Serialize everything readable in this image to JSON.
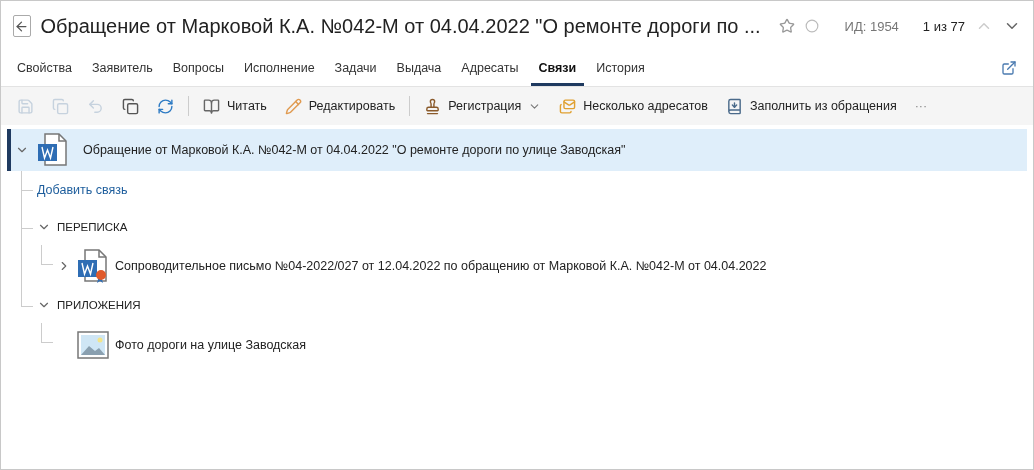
{
  "header": {
    "title": "Обращение от Марковой К.А. №042-М от 04.04.2022 \"О ремонте дороги по ...",
    "starred": false,
    "id_label": "ИД: 1954",
    "pager": "1 из 77",
    "prev_disabled": true
  },
  "tabs": [
    {
      "label": "Свойства",
      "selected": false
    },
    {
      "label": "Заявитель",
      "selected": false
    },
    {
      "label": "Вопросы",
      "selected": false
    },
    {
      "label": "Исполнение",
      "selected": false
    },
    {
      "label": "Задачи",
      "selected": false
    },
    {
      "label": "Выдача",
      "selected": false
    },
    {
      "label": "Адресаты",
      "selected": false
    },
    {
      "label": "Связи",
      "selected": true
    },
    {
      "label": "История",
      "selected": false
    }
  ],
  "toolbar": {
    "icon_buttons": [
      {
        "disabled": true
      },
      {
        "disabled": true
      },
      {
        "disabled": true
      },
      {
        "disabled": false
      },
      {
        "disabled": false
      }
    ],
    "actions": [
      {
        "label": "Читать",
        "dropdown": false
      },
      {
        "label": "Редактировать",
        "dropdown": false
      },
      {
        "label": "Регистрация",
        "dropdown": true
      },
      {
        "label": "Несколько адресатов",
        "dropdown": false
      },
      {
        "label": "Заполнить из обращения",
        "dropdown": false
      }
    ],
    "more": "···"
  },
  "tree": {
    "label": "Обращение от Марковой К.А. №042-М от 04.04.2022 \"О ремонте дороги по улице Заводская\"",
    "expanded": true,
    "selected": true,
    "children": [
      {
        "kind": "link",
        "label": "Добавить связь"
      },
      {
        "kind": "group",
        "label": "ПЕРЕПИСКА",
        "expanded": true,
        "children": [
          {
            "kind": "document",
            "label": "Сопроводительное письмо №04-2022/027 от 12.04.2022 по обращению от Марковой К.А. №042-М от 04.04.2022",
            "expanded": false
          }
        ]
      },
      {
        "kind": "group",
        "label": "ПРИЛОЖЕНИЯ",
        "expanded": true,
        "children": [
          {
            "kind": "image",
            "label": "Фото дороги на улице Заводская"
          }
        ]
      }
    ]
  }
}
